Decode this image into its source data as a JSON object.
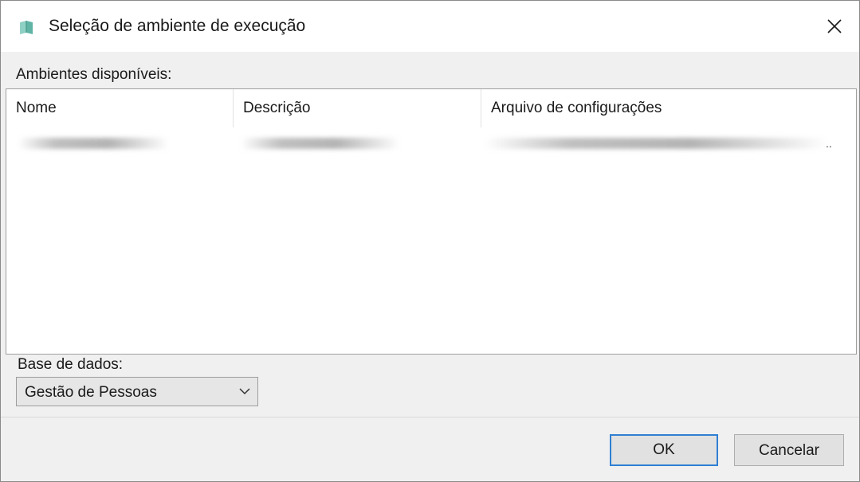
{
  "window": {
    "title": "Seleção de ambiente de execução",
    "app_icon": "book-icon",
    "close_icon": "close-icon"
  },
  "environments": {
    "label": "Ambientes disponíveis:",
    "columns": [
      "Nome",
      "Descrição",
      "Arquivo de configurações"
    ],
    "rows_obscured": true
  },
  "database": {
    "label": "Base de dados:",
    "selected": "Gestão de Pessoas"
  },
  "buttons": {
    "ok": "OK",
    "cancel": "Cancelar"
  },
  "colors": {
    "accent": "#2f7fd3",
    "icon": "#5fb4a6"
  }
}
